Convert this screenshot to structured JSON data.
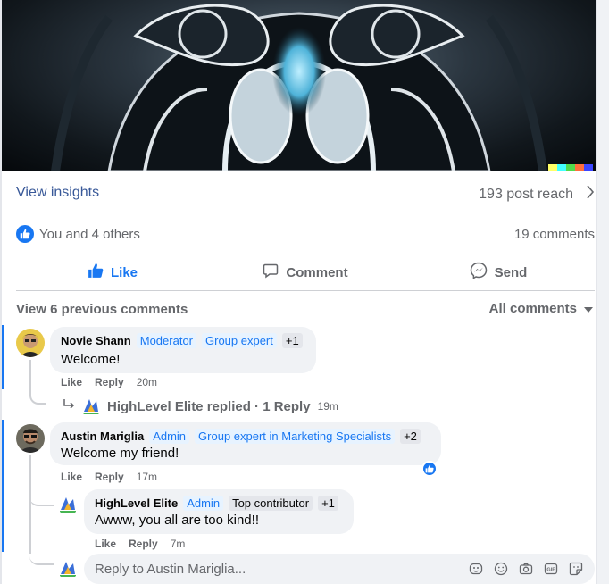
{
  "post": {
    "insights_label": "View insights",
    "reach_label": "193 post reach",
    "reactions_text": "You and 4 others",
    "comments_count": "19 comments"
  },
  "actions": {
    "like": "Like",
    "comment": "Comment",
    "send": "Send"
  },
  "comments_header": {
    "view_previous": "View 6 previous comments",
    "sort": "All comments"
  },
  "comments": [
    {
      "author": "Novie Shann",
      "badges": [
        "Moderator",
        "Group expert"
      ],
      "extra": "+1",
      "text": "Welcome!",
      "like": "Like",
      "reply": "Reply",
      "time": "20m",
      "replied_summary": "HighLevel Elite replied · 1 Reply",
      "replied_time": "19m"
    },
    {
      "author": "Austin Mariglia",
      "badges": [
        "Admin",
        "Group expert in Marketing Specialists"
      ],
      "extra": "+2",
      "text": "Welcome my friend!",
      "like": "Like",
      "reply": "Reply",
      "time": "17m",
      "reply_item": {
        "author": "HighLevel Elite",
        "badges": [
          "Admin"
        ],
        "grey_badge": "Top contributor",
        "extra": "+1",
        "text": "Awww, you all are too kind!!",
        "like": "Like",
        "reply": "Reply",
        "time": "7m"
      }
    }
  ],
  "reply_box": {
    "placeholder": "Reply to Austin Mariglia..."
  },
  "colors": {
    "accent": "#1877f2",
    "link": "#385898",
    "muted": "#65676b",
    "bubble": "#f0f2f5"
  }
}
